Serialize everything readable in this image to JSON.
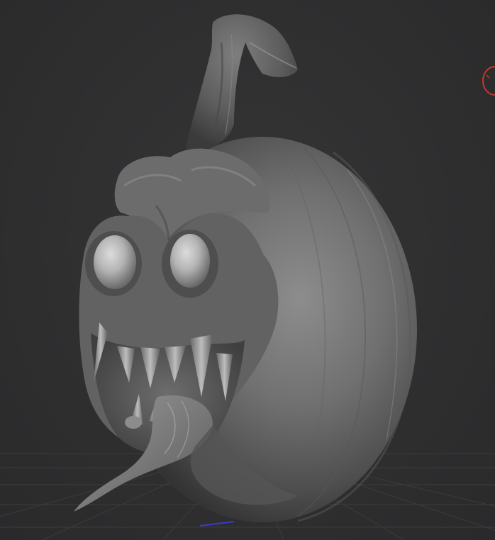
{
  "viewport": {
    "background_color": "#2f2f30",
    "grid_color": "#3c3c3d",
    "model": {
      "subject": "pumpkin-monster-sculpt",
      "material_color": "#8a8a8a"
    },
    "gizmo": {
      "icon": "rotation-gizmo-icon",
      "color": "#c0392b"
    },
    "axis_color": "#3a3ad0"
  }
}
